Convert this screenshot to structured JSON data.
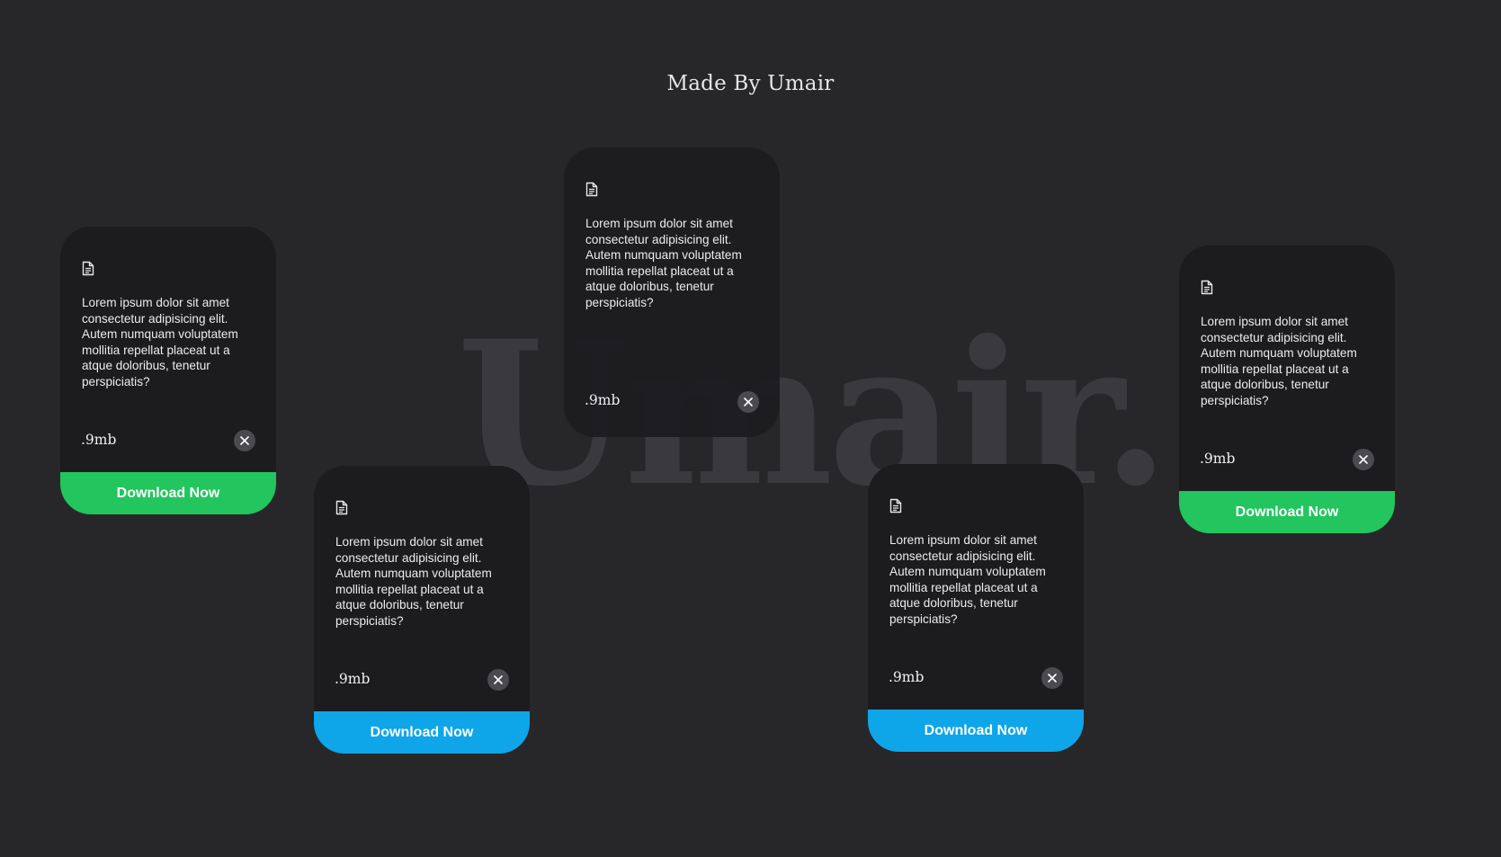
{
  "title": "Made By Umair",
  "watermark": "Umair.",
  "colors": {
    "background": "#27272a",
    "card": "#1c1c1f",
    "green": "#22c55e",
    "blue": "#0ea5e9"
  },
  "cards": [
    {
      "icon": "document-icon",
      "text": "Lorem ipsum dolor sit amet consectetur adipisicing elit. Autem numquam voluptatem mollitia repellat placeat ut a atque doloribus, tenetur perspiciatis?",
      "size": ".9mb",
      "close_icon": "close-icon",
      "button": "Download Now",
      "button_color": "green"
    },
    {
      "icon": "document-icon",
      "text": "Lorem ipsum dolor sit amet consectetur adipisicing elit. Autem numquam voluptatem mollitia repellat placeat ut a atque doloribus, tenetur perspiciatis?",
      "size": ".9mb",
      "close_icon": "close-icon",
      "button": "Download Now",
      "button_color": "blue"
    },
    {
      "icon": "document-icon",
      "text": "Lorem ipsum dolor sit amet consectetur adipisicing elit. Autem numquam voluptatem mollitia repellat placeat ut a atque doloribus, tenetur perspiciatis?",
      "size": ".9mb",
      "close_icon": "close-icon"
    },
    {
      "icon": "document-icon",
      "text": "Lorem ipsum dolor sit amet consectetur adipisicing elit. Autem numquam voluptatem mollitia repellat placeat ut a atque doloribus, tenetur perspiciatis?",
      "size": ".9mb",
      "close_icon": "close-icon",
      "button": "Download Now",
      "button_color": "blue"
    },
    {
      "icon": "document-icon",
      "text": "Lorem ipsum dolor sit amet consectetur adipisicing elit. Autem numquam voluptatem mollitia repellat placeat ut a atque doloribus, tenetur perspiciatis?",
      "size": ".9mb",
      "close_icon": "close-icon",
      "button": "Download Now",
      "button_color": "green"
    }
  ]
}
